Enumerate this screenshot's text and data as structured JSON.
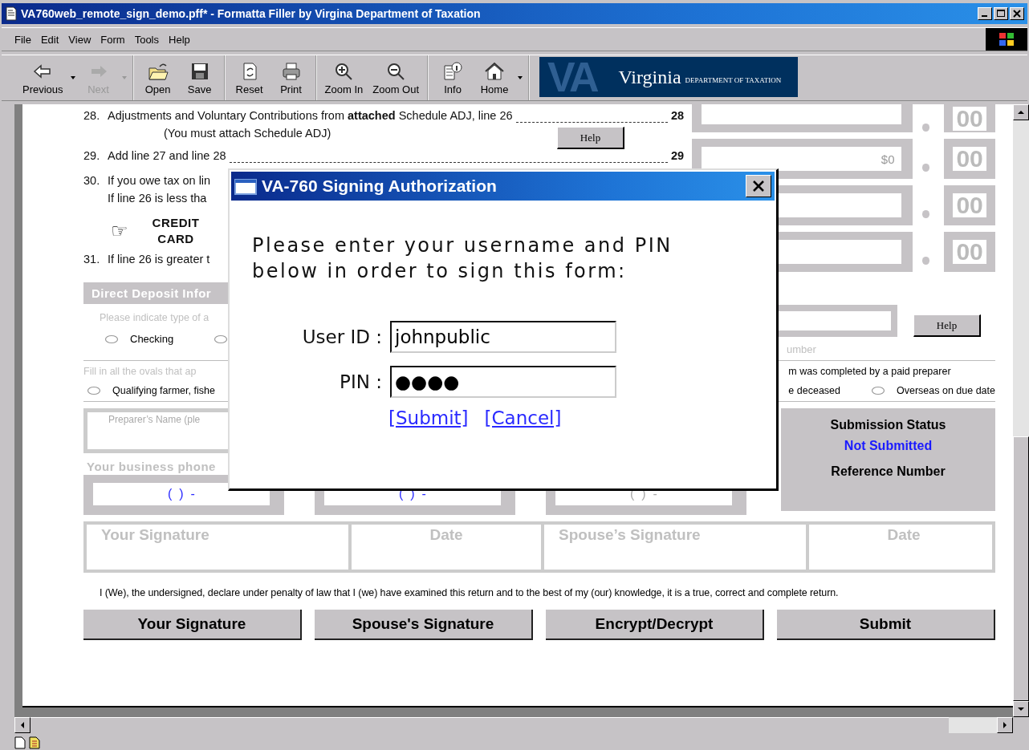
{
  "window": {
    "title": "VA760web_remote_sign_demo.pff* - Formatta Filler by Virgina Department of Taxation"
  },
  "menu": [
    "File",
    "Edit",
    "View",
    "Form",
    "Tools",
    "Help"
  ],
  "toolbar": [
    [
      {
        "label": "Previous",
        "kind": "back",
        "dropdown": true,
        "disabled": false
      },
      {
        "label": "Next",
        "kind": "forward",
        "dropdown": true,
        "disabled": true
      }
    ],
    [
      {
        "label": "Open",
        "kind": "open",
        "dropdown": false,
        "disabled": false
      },
      {
        "label": "Save",
        "kind": "save",
        "dropdown": false,
        "disabled": false
      }
    ],
    [
      {
        "label": "Reset",
        "kind": "reset",
        "dropdown": false,
        "disabled": false
      },
      {
        "label": "Print",
        "kind": "print",
        "dropdown": false,
        "disabled": false
      }
    ],
    [
      {
        "label": "Zoom In",
        "kind": "zoomin",
        "dropdown": false,
        "disabled": false
      },
      {
        "label": "Zoom Out",
        "kind": "zoomout",
        "dropdown": false,
        "disabled": false
      }
    ],
    [
      {
        "label": "Info",
        "kind": "info",
        "dropdown": false,
        "disabled": false
      },
      {
        "label": "Home",
        "kind": "home",
        "dropdown": true,
        "disabled": false
      }
    ]
  ],
  "banner": {
    "logo": "VA",
    "title": "Virginia",
    "subtitle": "DEPARTMENT OF TAXATION"
  },
  "form": {
    "lines": [
      {
        "number": "28.",
        "text": "Adjustments and Voluntary Contributions from **attached** Schedule ADJ, line 26",
        "line_ref": "28",
        "note": "(You must attach Schedule ADJ)",
        "help": "Help"
      },
      {
        "number": "29.",
        "text": "Add line 27 and line 28",
        "line_ref": "29"
      },
      {
        "number": "30.",
        "text": "If you owe tax on lin",
        "text2": "If line 26 is less tha",
        "pointer": "☞",
        "credit_card": "CREDIT CARD"
      },
      {
        "number": "31.",
        "text": "If line 26 is greater t"
      }
    ],
    "amounts": [
      {
        "cents": "00"
      },
      {
        "value": "$0",
        "cents": "00"
      },
      {
        "cents": "00"
      },
      {
        "cents": "00"
      }
    ],
    "direct_deposit": {
      "header": "Direct Deposit Infor",
      "hint": "Please indicate type of a",
      "options": [
        {
          "label": "Checking",
          "selected": false
        },
        {
          "selected": false
        }
      ],
      "help": "Help",
      "caption": "umber"
    },
    "ovals": {
      "instruction": "Fill in all the ovals that ap",
      "instruction_right": "m was completed by a paid preparer",
      "items": [
        {
          "label": "Qualifying farmer, fishe",
          "checked": false
        }
      ],
      "right_text": "e deceased",
      "right_items": [
        {
          "label": "Overseas on due date",
          "checked": false
        }
      ]
    },
    "preparer": {
      "name_caption": "Preparer’s Name (ple",
      "phone_caption": "Your business phone",
      "phones": [
        {
          "text": "(  )  -",
          "enabled": true
        },
        {
          "text": "(  )  -",
          "enabled": true
        },
        {
          "text": "(  )  -",
          "enabled": false
        }
      ]
    },
    "status": {
      "title": "Submission Status",
      "value": "Not Submitted",
      "reference_label": "Reference Number"
    },
    "signatures": [
      {
        "label": "Your Signature",
        "kind": "signature"
      },
      {
        "label": "Date",
        "kind": "date"
      },
      {
        "label": "Spouse’s Signature",
        "kind": "signature"
      },
      {
        "label": "Date",
        "kind": "date"
      }
    ],
    "declaration": "I (We), the undersigned, declare under penalty of law that I (we) have examined this return and to the best of my (our) knowledge, it is a true, correct and complete return.",
    "buttons": [
      "Your Signature",
      "Spouse's Signature",
      "Encrypt/Decrypt",
      "Submit"
    ]
  },
  "dialog": {
    "title": "VA-760 Signing Authorization",
    "message": "Please enter your username and PIN below in order to sign this form:",
    "fields": [
      {
        "label": "User ID :",
        "value": "johnpublic"
      },
      {
        "label": "PIN :",
        "value": "●●●●"
      }
    ],
    "links": [
      "[Submit]",
      "[Cancel]"
    ]
  }
}
